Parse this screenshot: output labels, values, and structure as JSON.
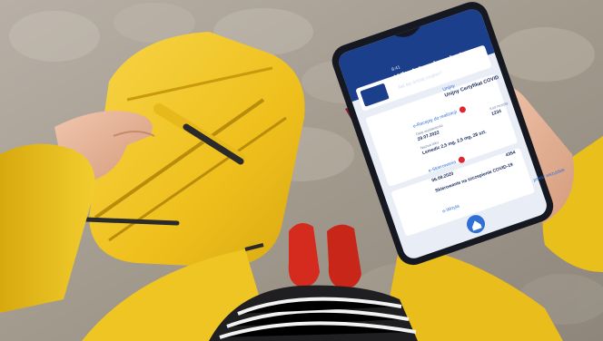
{
  "app": {
    "status_time": "8:41",
    "greeting": "Witaj Agnieszka!",
    "subtitle": "Jak się dzisiaj czujesz?",
    "certificate_label": "Unijny",
    "certificate_title": "Unijny Certyfikat COVID",
    "section_referrals": "e-Skierowania",
    "section_prescriptions": "e-Recepty do realizacji",
    "field_date_label": "Data wystawienia",
    "field_date_value": "29.07.2022",
    "field_drug_label": "Nazwa leku",
    "field_drug_value": "Lemedic 2,5 mg, 2,5 mg, 28 szt.",
    "field_code_label": "Kod recepty",
    "field_code_value": "1234",
    "field_code2_value": "4354",
    "referral_date_value": "06.09.2020",
    "referral_title": "Skierowanie na szczepienie COVID-19",
    "footer_link": "e-Wizyta",
    "footer_link_right": "pokaż wszystkie"
  },
  "colors": {
    "phone_header": "#1c3f8c",
    "screen_bg": "#e9eef6",
    "accent": "#2f6fd6",
    "suitcase": "#f2c227",
    "jacket": "#ecc21f",
    "shoes": "#d52b1e",
    "passport": "#7a1f35"
  }
}
